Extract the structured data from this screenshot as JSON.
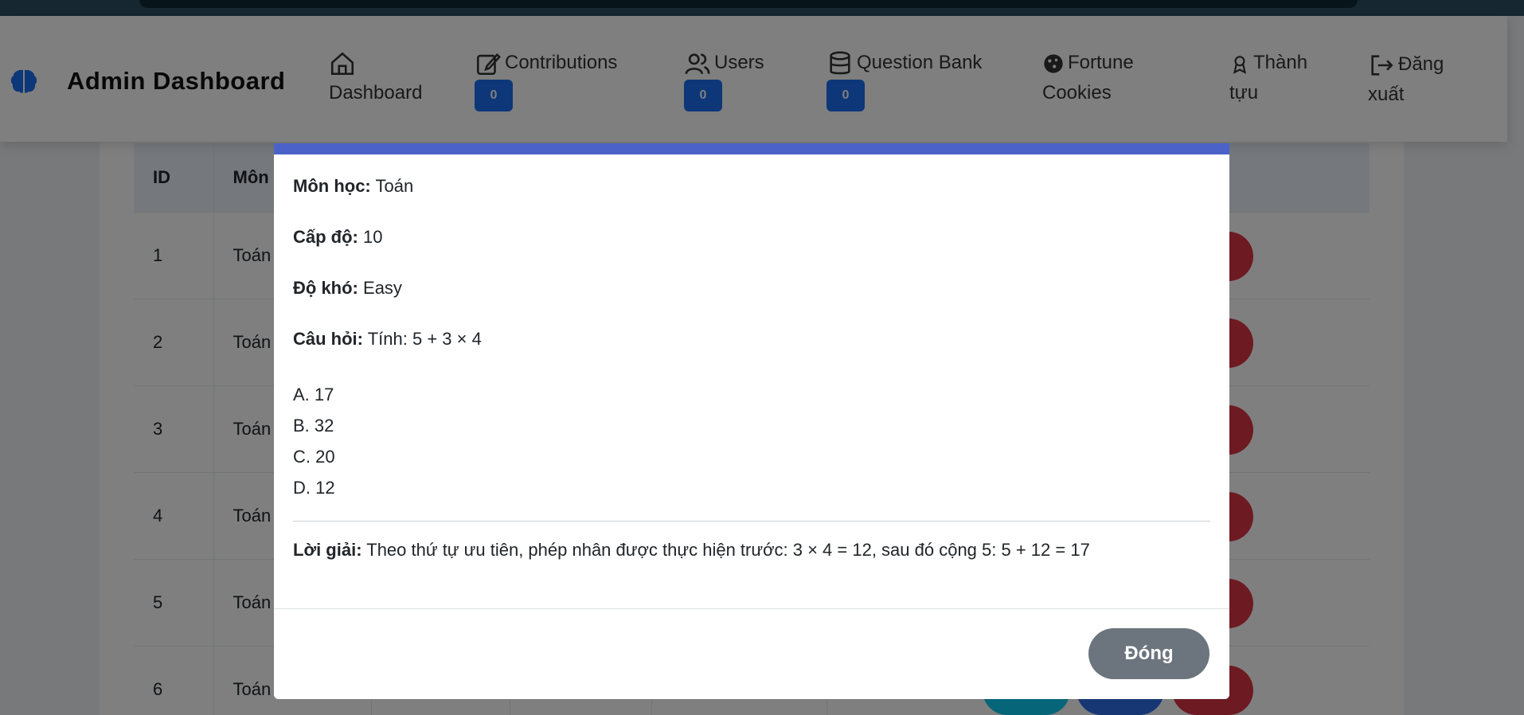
{
  "brand": {
    "title": "Admin Dashboard"
  },
  "nav": {
    "dashboard": "Dashboard",
    "contributions": {
      "label": "Contributions",
      "badge": "0"
    },
    "users": {
      "label": "Users",
      "badge": "0"
    },
    "question_bank": {
      "label": "Question Bank",
      "badge": "0"
    },
    "fortune_cookies_1": "Fortune",
    "fortune_cookies_2": "Cookies",
    "achievements_1": "Thành",
    "achievements_2": "tựu",
    "logout_1": "Đăng",
    "logout_2": "xuất"
  },
  "table": {
    "headers": {
      "id": "ID",
      "subject": "Môn"
    },
    "rows": [
      {
        "id": "1",
        "subject": "Toán"
      },
      {
        "id": "2",
        "subject": "Toán"
      },
      {
        "id": "3",
        "subject": "Toán"
      },
      {
        "id": "4",
        "subject": "Toán"
      },
      {
        "id": "5",
        "subject": "Toán"
      },
      {
        "id": "6",
        "subject": "Toán"
      }
    ]
  },
  "modal": {
    "subject_label": "Môn học:",
    "subject_value": "Toán",
    "level_label": "Cấp độ:",
    "level_value": "10",
    "difficulty_label": "Độ khó:",
    "difficulty_value": "Easy",
    "question_label": "Câu hỏi:",
    "question_value": "Tính: 5 + 3 × 4",
    "options": [
      "A. 17",
      "B. 32",
      "C. 20",
      "D. 12"
    ],
    "solution_label": "Lời giải:",
    "solution_value": "Theo thứ tự ưu tiên, phép nhân được thực hiện trước: 3 × 4 = 12, sau đó cộng 5: 5 + 12 = 17",
    "close_label": "Đóng"
  },
  "colors": {
    "accent": "#4b63c9",
    "badge": "#1a6ff0",
    "brand_icon": "#1a6ff0",
    "danger": "#dc3545",
    "info": "#0dcaf0",
    "primary": "#2f6ee8",
    "secondary": "#6c757d"
  },
  "icons": {
    "brand": "brain-icon",
    "dashboard": "house-icon",
    "contributions": "pencil-square-icon",
    "users": "people-icon",
    "question_bank": "database-icon",
    "fortune_cookies": "cookie-icon",
    "achievements": "award-icon",
    "logout": "box-arrow-right-icon"
  }
}
